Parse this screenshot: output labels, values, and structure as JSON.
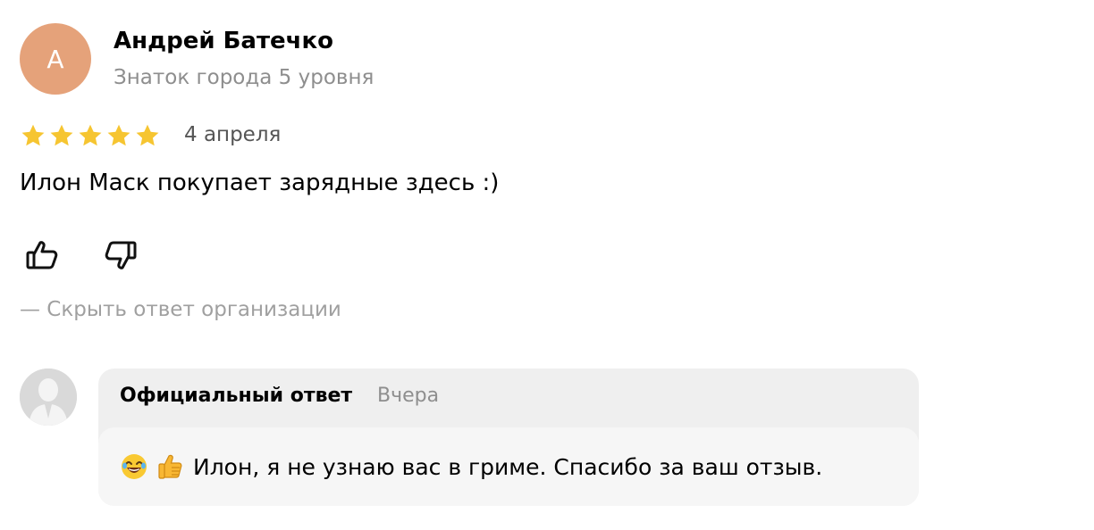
{
  "review": {
    "author": {
      "initial": "А",
      "name": "Андрей Батечко",
      "level": "Знаток города 5 уровня",
      "avatar_color": "#e5a27a"
    },
    "rating": {
      "value": 5,
      "max": 5,
      "star_color": "#f6c531"
    },
    "date": "4 апреля",
    "text": "Илон Маск покупает зарядные здесь :)",
    "actions": {
      "like_icon": "thumb-up-icon",
      "dislike_icon": "thumb-down-icon"
    },
    "toggle_reply_label": "— Скрыть ответ организации"
  },
  "org_reply": {
    "title": "Официальный ответ",
    "date": "Вчера",
    "emojis": [
      "😂",
      "👍"
    ],
    "text": "Илон, я не узнаю вас в гриме.  Спасибо за ваш отзыв."
  }
}
